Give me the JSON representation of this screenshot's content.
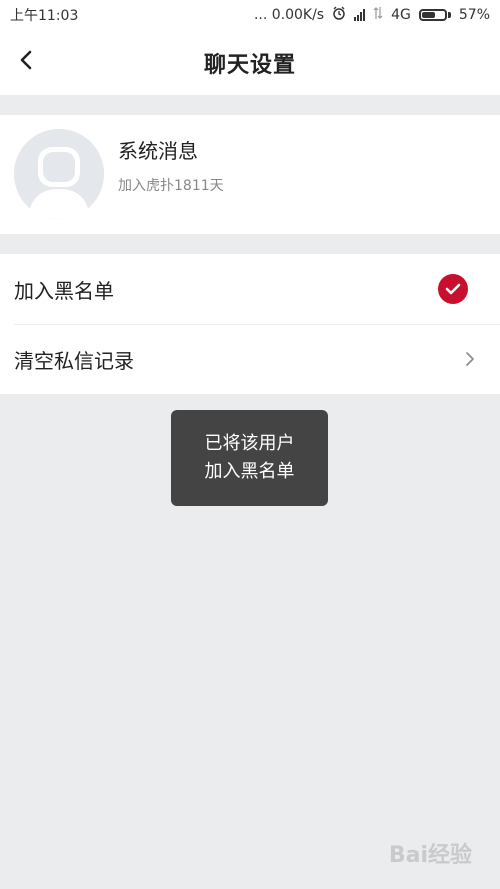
{
  "status_bar": {
    "time": "上午11:03",
    "speed": "... 0.00K/s",
    "network": "4G",
    "battery": "57%",
    "battery_level": 0.57
  },
  "nav": {
    "back_icon": "chevron-left-icon",
    "title": "聊天设置"
  },
  "profile": {
    "name": "系统消息",
    "joined": "加入虎扑1811天",
    "avatar_icon": "default-avatar-icon"
  },
  "settings": {
    "blacklist_label": "加入黑名单",
    "blacklist_checked": true,
    "clear_label": "清空私信记录"
  },
  "toast": {
    "line1": "已将该用户",
    "line2": "加入黑名单"
  },
  "watermark": {
    "text": "Bai经验"
  },
  "colors": {
    "accent": "#c8102e",
    "background": "#ebecee",
    "toast_bg": "#444444"
  }
}
